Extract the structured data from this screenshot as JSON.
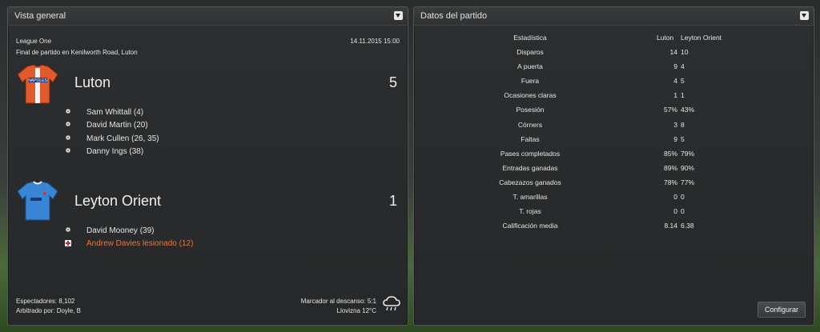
{
  "left_panel": {
    "title": "Vista general",
    "competition": "League One",
    "datetime": "14.11.2015 15:00",
    "venue_text": "Final de partido en Kenilworth Road, Luton",
    "home": {
      "name": "Luton",
      "score": "5",
      "shirt_color": "#e05a2c",
      "shirt_text": "NAPOLES",
      "events": [
        {
          "icon": "ball-icon",
          "text": "Sam Whittall (4)"
        },
        {
          "icon": "ball-icon",
          "text": "David Martin (20)"
        },
        {
          "icon": "ball-icon",
          "text": "Mark Cullen (26, 35)"
        },
        {
          "icon": "ball-icon",
          "text": "Danny Ings (38)"
        }
      ]
    },
    "away": {
      "name": "Leyton Orient",
      "score": "1",
      "shirt_color": "#3a86d6",
      "events": [
        {
          "icon": "ball-icon",
          "text": "David Mooney (39)"
        },
        {
          "icon": "injury-icon",
          "text": "Andrew Davies lesionado (12)"
        }
      ]
    },
    "footer": {
      "attendance": "Espectadores: 8,102",
      "referee": "Arbitrado por: Doyle, B",
      "halftime": "Marcador al descanso: 5:1",
      "weather": "Llovizna 12°C",
      "weather_icon": "rain-cloud-icon"
    }
  },
  "right_panel": {
    "title": "Datos del partido",
    "header": {
      "label": "Estadística",
      "home": "Luton",
      "away": "Leyton Orient"
    },
    "stats": [
      {
        "label": "Disparos",
        "home": "14",
        "away": "10"
      },
      {
        "label": "A puerta",
        "home": "9",
        "away": "4"
      },
      {
        "label": "Fuera",
        "home": "4",
        "away": "5"
      },
      {
        "label": "Ocasiones claras",
        "home": "1",
        "away": "1"
      },
      {
        "label": "Posesión",
        "home": "57%",
        "away": "43%"
      },
      {
        "label": "Córners",
        "home": "3",
        "away": "8"
      },
      {
        "label": "Faltas",
        "home": "9",
        "away": "5"
      },
      {
        "label": "Pases completados",
        "home": "85%",
        "away": "79%"
      },
      {
        "label": "Entradas ganadas",
        "home": "89%",
        "away": "90%"
      },
      {
        "label": "Cabezazos ganados",
        "home": "78%",
        "away": "77%"
      },
      {
        "label": "T. amarillas",
        "home": "0",
        "away": "0"
      },
      {
        "label": "T. rojas",
        "home": "0",
        "away": "0"
      },
      {
        "label": "Calificación media",
        "home": "8.14",
        "away": "6.38"
      }
    ],
    "configure_button": "Configurar"
  },
  "colors": {
    "injury_text": "#e8783c",
    "panel_bg": "#2a2c2e"
  }
}
